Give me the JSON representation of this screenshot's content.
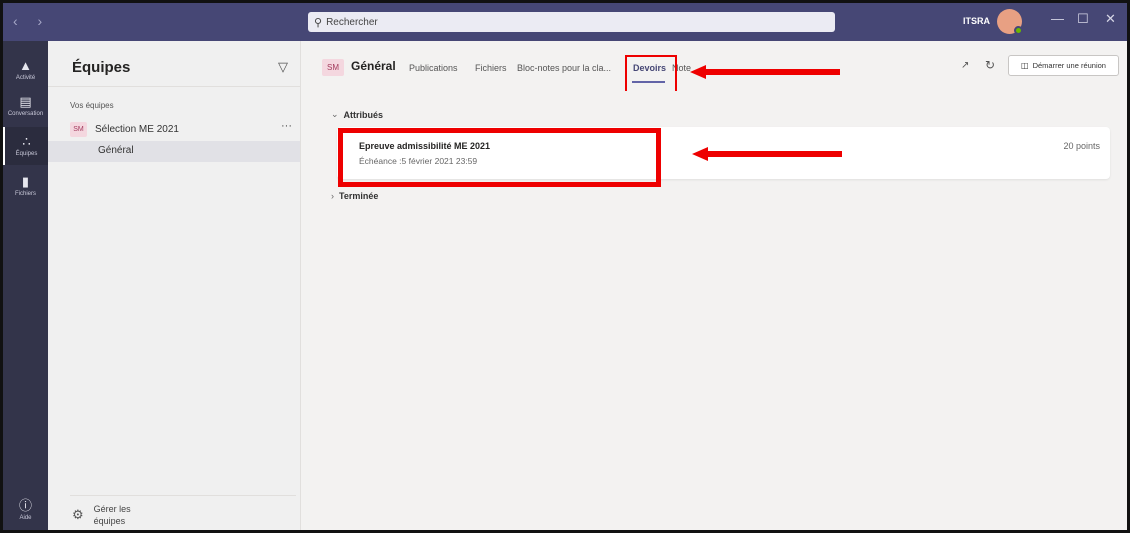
{
  "titlebar": {
    "nav": "‹ ›",
    "search_placeholder": "Rechercher",
    "user": "ITSRA",
    "min": "—",
    "max": "☐",
    "close": "✕"
  },
  "appbar": {
    "items": [
      {
        "label": "Activité",
        "icon": "bell-icon"
      },
      {
        "label": "Conversation",
        "icon": "chat-icon"
      },
      {
        "label": "Équipes",
        "icon": "teams-icon"
      },
      {
        "label": "Fichiers",
        "icon": "file-icon"
      },
      {
        "label": "Aide",
        "icon": "help-icon"
      }
    ]
  },
  "teams_pane": {
    "title": "Équipes",
    "section": "Vos équipes",
    "team": {
      "avatar": "SM",
      "name": "Sélection ME 2021",
      "more": "···"
    },
    "channel": "Général",
    "manage": "Gérer les équipes"
  },
  "channel": {
    "avatar": "SM",
    "name": "Général",
    "tabs": [
      "Publications",
      "Fichiers",
      "Bloc-notes pour la cla...",
      "Devoirs",
      "Note"
    ],
    "active_tab": "Devoirs",
    "meet_button": "Démarrer une réunion"
  },
  "assignments": {
    "assigned_label": "Attribués",
    "card": {
      "title": "Epreuve admissibilité ME 2021",
      "due": "Échéance :5 février 2021 23:59",
      "points": "20 points"
    },
    "done_label": "Terminée"
  },
  "colors": {
    "titlebar": "#464775",
    "appbar": "#33344a",
    "accent": "#6264a7",
    "highlight": "#ee0000"
  }
}
